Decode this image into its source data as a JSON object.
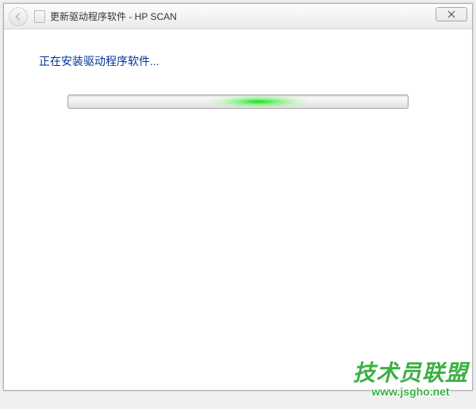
{
  "window": {
    "title": "更新驱动程序软件 - HP SCAN"
  },
  "content": {
    "status_text": "正在安装驱动程序软件..."
  },
  "watermark": {
    "main": "技术员联盟",
    "url": "www.jsgho.net"
  }
}
